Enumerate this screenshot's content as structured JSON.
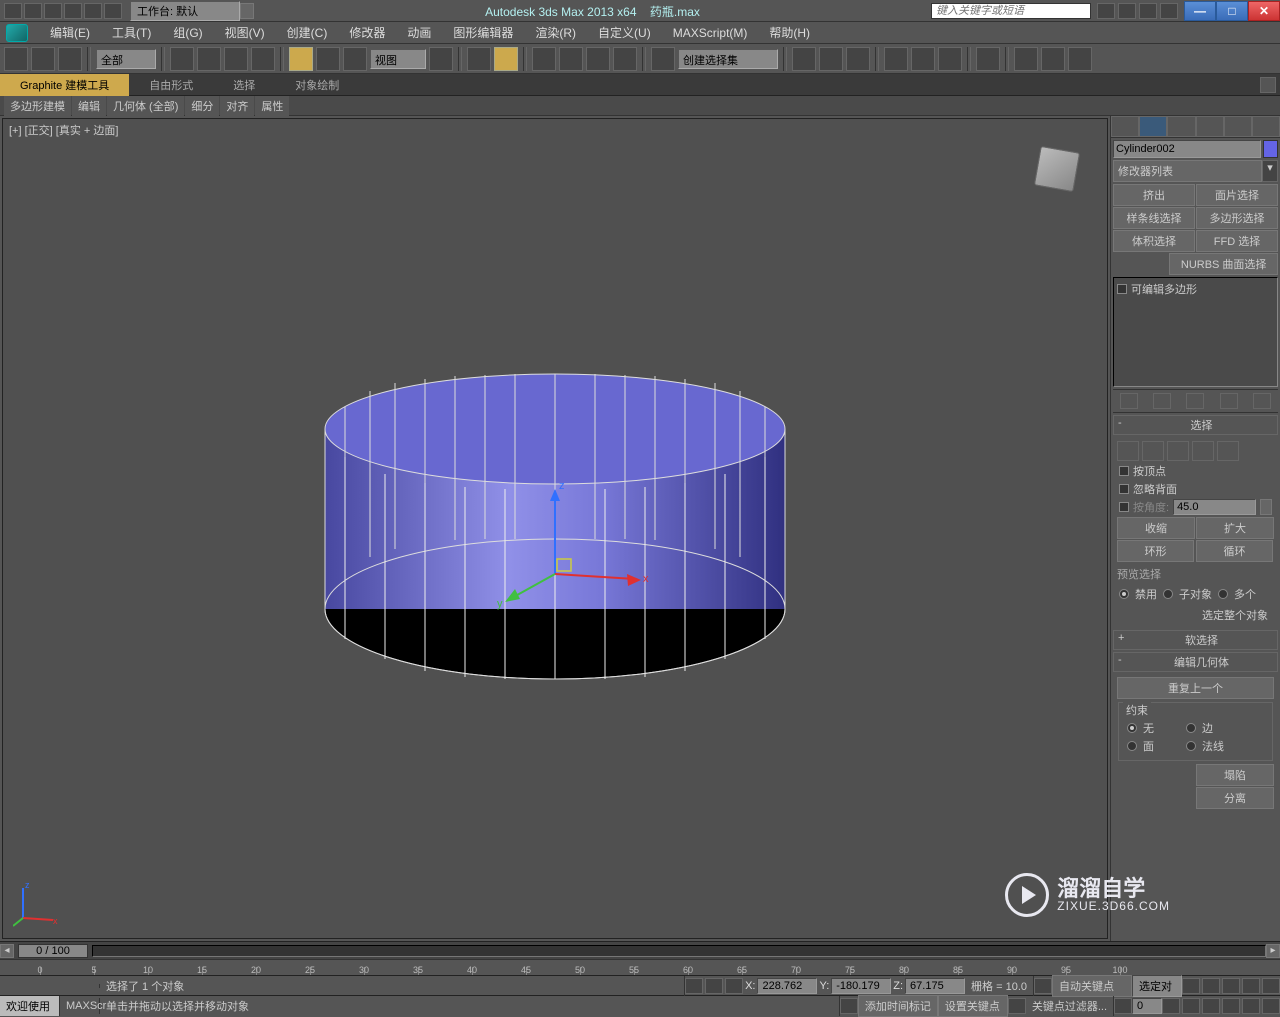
{
  "title": {
    "app": "Autodesk 3ds Max  2013 x64",
    "file": "药瓶.max",
    "workspace_label": "工作台: 默认",
    "search_placeholder": "键入关键字或短语"
  },
  "menu": [
    "编辑(E)",
    "工具(T)",
    "组(G)",
    "视图(V)",
    "创建(C)",
    "修改器",
    "动画",
    "图形编辑器",
    "渲染(R)",
    "自定义(U)",
    "MAXScript(M)",
    "帮助(H)"
  ],
  "toolbar": {
    "filter": "全部",
    "refcoord": "视图",
    "named_sel": "创建选择集"
  },
  "ribbon": {
    "tabs": [
      "Graphite 建模工具",
      "自由形式",
      "选择",
      "对象绘制"
    ],
    "sub": [
      "多边形建模",
      "编辑",
      "几何体 (全部)",
      "细分",
      "对齐",
      "属性"
    ]
  },
  "viewport": {
    "label": "[+] [正交] [真实 + 边面]",
    "axes": {
      "x": "x",
      "y": "y",
      "z": "z"
    }
  },
  "cmdpanel": {
    "object_name": "Cylinder002",
    "modifier_list": "修改器列表",
    "buttons1": [
      "挤出",
      "面片选择"
    ],
    "buttons2": [
      "样条线选择",
      "多边形选择"
    ],
    "buttons3": [
      "体积选择",
      "FFD 选择"
    ],
    "buttons4": "NURBS 曲面选择",
    "stack_item": "可编辑多边形",
    "rollouts": {
      "select_title": "选择",
      "by_vertex": "按顶点",
      "ignore_backfacing": "忽略背面",
      "by_angle": "按角度:",
      "angle_value": "45.0",
      "shrink": "收缩",
      "grow": "扩大",
      "ring": "环形",
      "loop": "循环",
      "preview_title": "预览选择",
      "preview_opts": [
        "禁用",
        "子对象",
        "多个"
      ],
      "select_whole": "选定整个对象",
      "soft_select": "软选择",
      "edit_geom": "编辑几何体",
      "repeat_last": "重复上一个",
      "constraints": "约束",
      "c_none": "无",
      "c_edge": "边",
      "c_face": "面",
      "c_normal": "法线",
      "collapse": "塌陷",
      "detach": "分离"
    }
  },
  "timeline": {
    "frame": "0 / 100",
    "ticks": [
      0,
      5,
      10,
      15,
      20,
      25,
      30,
      35,
      40,
      45,
      50,
      55,
      60,
      65,
      70,
      75,
      80,
      85,
      90,
      95,
      100
    ]
  },
  "status": {
    "welcome": "欢迎使用",
    "maxscr": "MAXScr",
    "sel_msg": "选择了 1 个对象",
    "prompt": "单击并拖动以选择并移动对象",
    "x": "228.762",
    "y": "-180.179",
    "z": "67.175",
    "grid": "栅格 = 10.0",
    "add_time_tag": "添加时间标记",
    "auto_key": "自动关键点",
    "set_key": "设置关键点",
    "key_filter": "关键点过滤器...",
    "sel_set": "选定对",
    "spin0": "0"
  },
  "watermark": {
    "text": "溜溜自学",
    "sub": "ZIXUE.3D66.COM"
  }
}
